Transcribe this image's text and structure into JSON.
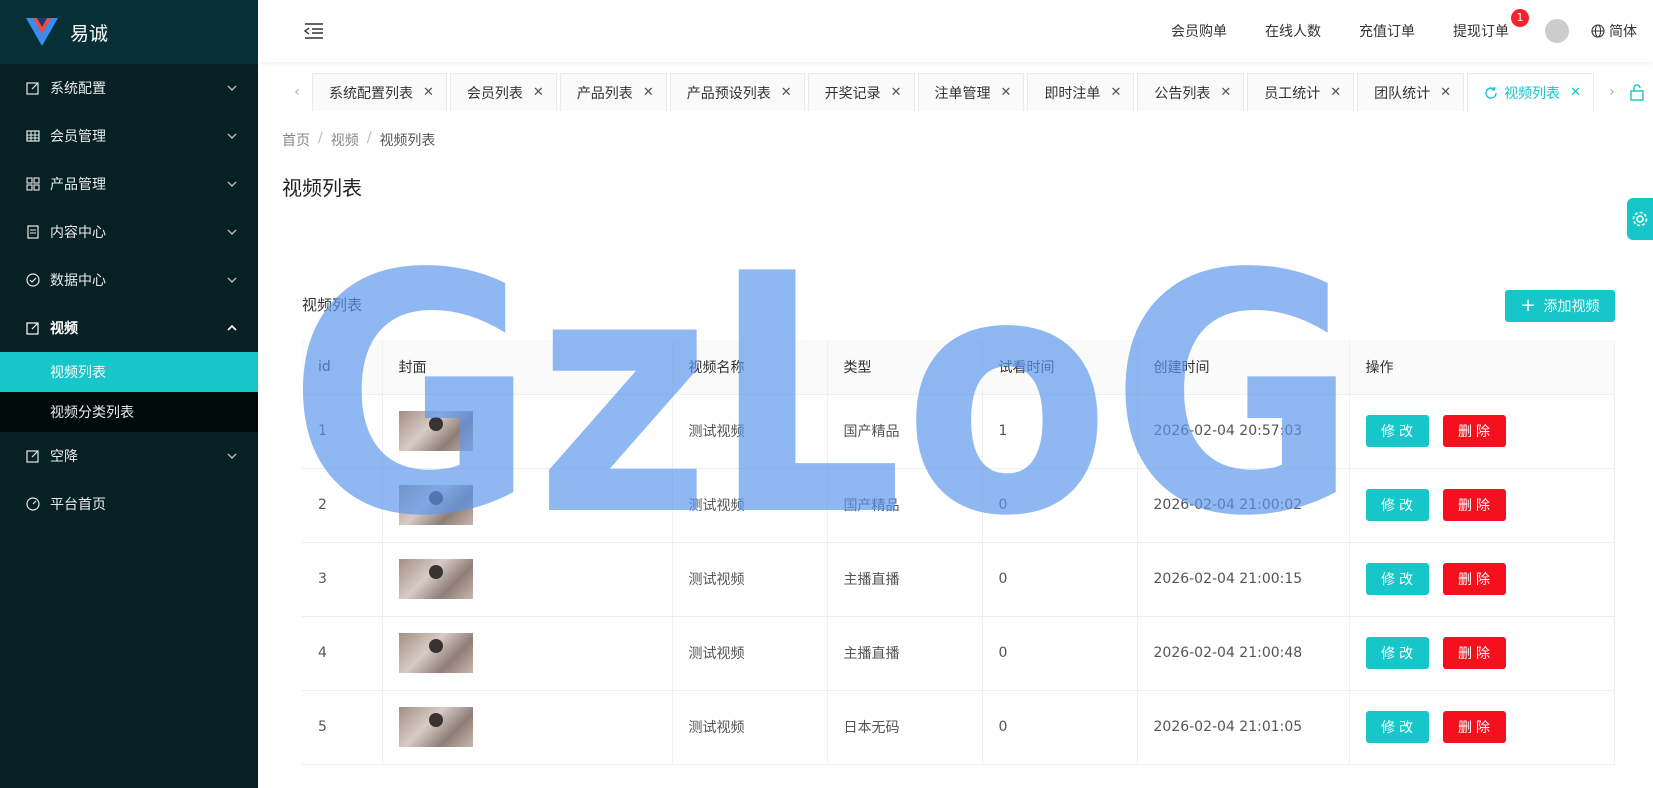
{
  "app": {
    "logo_text": "易诚"
  },
  "sidebar": {
    "items": [
      {
        "label": "系统配置"
      },
      {
        "label": "会员管理"
      },
      {
        "label": "产品管理"
      },
      {
        "label": "内容中心"
      },
      {
        "label": "数据中心"
      },
      {
        "label": "视频"
      },
      {
        "label": "空降"
      },
      {
        "label": "平台首页"
      }
    ],
    "video_sub": [
      {
        "label": "视频列表"
      },
      {
        "label": "视频分类列表"
      }
    ]
  },
  "header": {
    "links": [
      "会员购单",
      "在线人数",
      "充值订单",
      "提现订单"
    ],
    "badge_count": "1",
    "language": "简体"
  },
  "tabs": [
    {
      "label": "系统配置列表"
    },
    {
      "label": "会员列表"
    },
    {
      "label": "产品列表"
    },
    {
      "label": "产品预设列表"
    },
    {
      "label": "开奖记录"
    },
    {
      "label": "注单管理"
    },
    {
      "label": "即时注单"
    },
    {
      "label": "公告列表"
    },
    {
      "label": "员工统计"
    },
    {
      "label": "团队统计"
    },
    {
      "label": "视频列表"
    }
  ],
  "breadcrumb": {
    "home": "首页",
    "section": "视频",
    "current": "视频列表"
  },
  "page": {
    "title": "视频列表",
    "card_title": "视频列表",
    "add_button": "添加视频"
  },
  "table": {
    "headers": [
      "id",
      "封面",
      "视频名称",
      "类型",
      "试看时间",
      "创建时间",
      "操作"
    ],
    "rows": [
      {
        "id": "1",
        "name": "测试视频",
        "type": "国产精品",
        "trial": "1",
        "created": "2026-02-04 20:57:03"
      },
      {
        "id": "2",
        "name": "测试视频",
        "type": "国产精品",
        "trial": "0",
        "created": "2026-02-04 21:00:02"
      },
      {
        "id": "3",
        "name": "测试视频",
        "type": "主播直播",
        "trial": "0",
        "created": "2026-02-04 21:00:15"
      },
      {
        "id": "4",
        "name": "测试视频",
        "type": "主播直播",
        "trial": "0",
        "created": "2026-02-04 21:00:48"
      },
      {
        "id": "5",
        "name": "测试视频",
        "type": "日本无码",
        "trial": "0",
        "created": "2026-02-04 21:01:05"
      }
    ],
    "edit_label": "修改",
    "delete_label": "删除"
  },
  "watermark": {
    "text": "GzLoG"
  },
  "colors": {
    "accent": "#17c6c8",
    "danger": "#f5101e",
    "sidebar": "#062023"
  }
}
